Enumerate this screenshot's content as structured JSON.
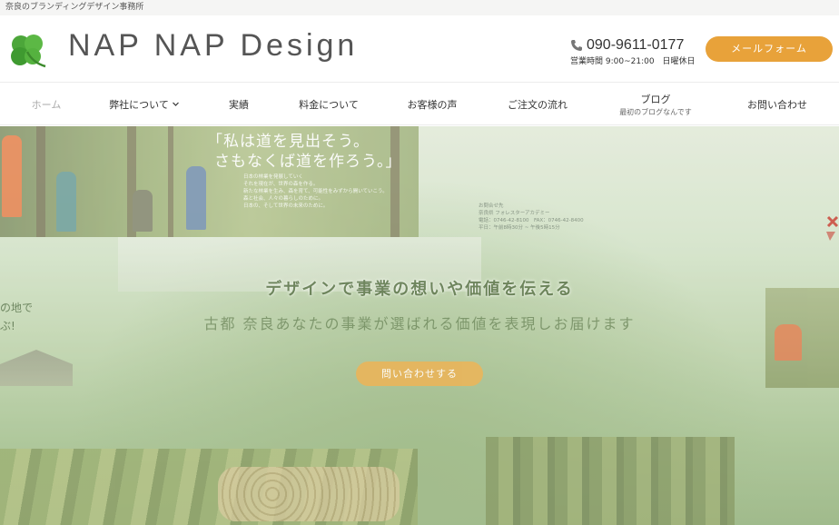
{
  "topbar": {
    "tagline": "奈良のブランディングデザイン事務所"
  },
  "header": {
    "logo_text": "NAP NAP Design",
    "phone": "090-9611-0177",
    "hours": "営業時間 9:00~21:00　日曜休日",
    "mail_button": "メールフォーム"
  },
  "nav": {
    "items": [
      {
        "label": "ホーム"
      },
      {
        "label": "弊社について"
      },
      {
        "label": "実績"
      },
      {
        "label": "料金について"
      },
      {
        "label": "お客様の声"
      },
      {
        "label": "ご注文の流れ"
      },
      {
        "label": "ブログ",
        "sub": "最初のブログなんです"
      },
      {
        "label": "お問い合わせ"
      }
    ]
  },
  "hero": {
    "title": "デザインで事業の想いや価値を伝える",
    "subtitle": "古都 奈良あなたの事業が選ばれる価値を表現しお届けます",
    "cta": "問い合わせする",
    "photo_quote_line1": "「私は道を見出そう。",
    "photo_quote_line2": "さもなくば道を作ろう。」",
    "photo_small": "日本の林業を発展していく\nそれを現在が、世界の森を作る。\n新たな林業を生み、森を育て、可能性をみずから開いていこう。\n森と社会、人々の暮らしのために。\n日本の、そして世界の未来のために。",
    "contact_card": "お問合せ先\n奈良県 フォレスターアカデミー\n電話：0746-42-8100　FAX：0746-42-8400\n平日：午前8時30分 ~ 午後5時15分",
    "side_text_line1": "の地で",
    "side_text_line2": "ぶ!"
  },
  "colors": {
    "accent": "#e8a23a",
    "topbar_bg": "#f5f5f4",
    "nav_text": "#333333",
    "logo_green": "#4ca63a"
  }
}
